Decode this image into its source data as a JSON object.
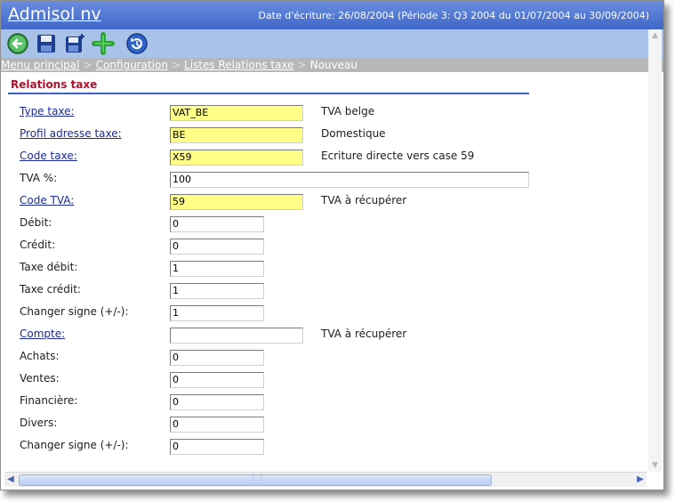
{
  "app": {
    "title": "Admisol nv",
    "date_info": "Date d'écriture: 26/08/2004 (Période 3: Q3 2004 du 01/07/2004 au 30/09/2004)"
  },
  "toolbar": {
    "icons": [
      "back-icon",
      "save-icon",
      "save-new-icon",
      "add-icon",
      "refresh-icon"
    ]
  },
  "breadcrumb": {
    "items": [
      "Menu principal",
      "Configuration",
      "Listes Relations taxe"
    ],
    "separator": ">",
    "current": "Nouveau"
  },
  "section": {
    "title": "Relations taxe"
  },
  "fields": [
    {
      "label": "Type taxe:",
      "value": "VAT_BE",
      "desc": "TVA belge"
    },
    {
      "label": "Profil adresse taxe:",
      "value": "BE",
      "desc": "Domestique"
    },
    {
      "label": "Code taxe:",
      "value": "X59",
      "desc": "Ecriture directe vers case 59"
    },
    {
      "label": "TVA %:",
      "value": "100"
    },
    {
      "label": "Code TVA:",
      "value": "59",
      "desc": "TVA à récupérer"
    },
    {
      "label": "Débit:",
      "value": "0"
    },
    {
      "label": "Crédit:",
      "value": "0"
    },
    {
      "label": "Taxe débit:",
      "value": "1"
    },
    {
      "label": "Taxe crédit:",
      "value": "1"
    },
    {
      "label": "Changer signe (+/-):",
      "value": "1"
    },
    {
      "label": "Compte:",
      "value": "",
      "desc": "TVA à récupérer"
    },
    {
      "label": "Achats:",
      "value": "0"
    },
    {
      "label": "Ventes:",
      "value": "0"
    },
    {
      "label": "Financière:",
      "value": "0"
    },
    {
      "label": "Divers:",
      "value": "0"
    },
    {
      "label": "Changer signe (+/-):",
      "value": "0"
    }
  ],
  "colors": {
    "title_bar": "#4a72d1",
    "toolbar": "#a9c2e8",
    "breadcrumb": "#b7b7b7",
    "section_title": "#b0102a",
    "required_field": "#ffff88",
    "link": "#1a2a9a"
  }
}
